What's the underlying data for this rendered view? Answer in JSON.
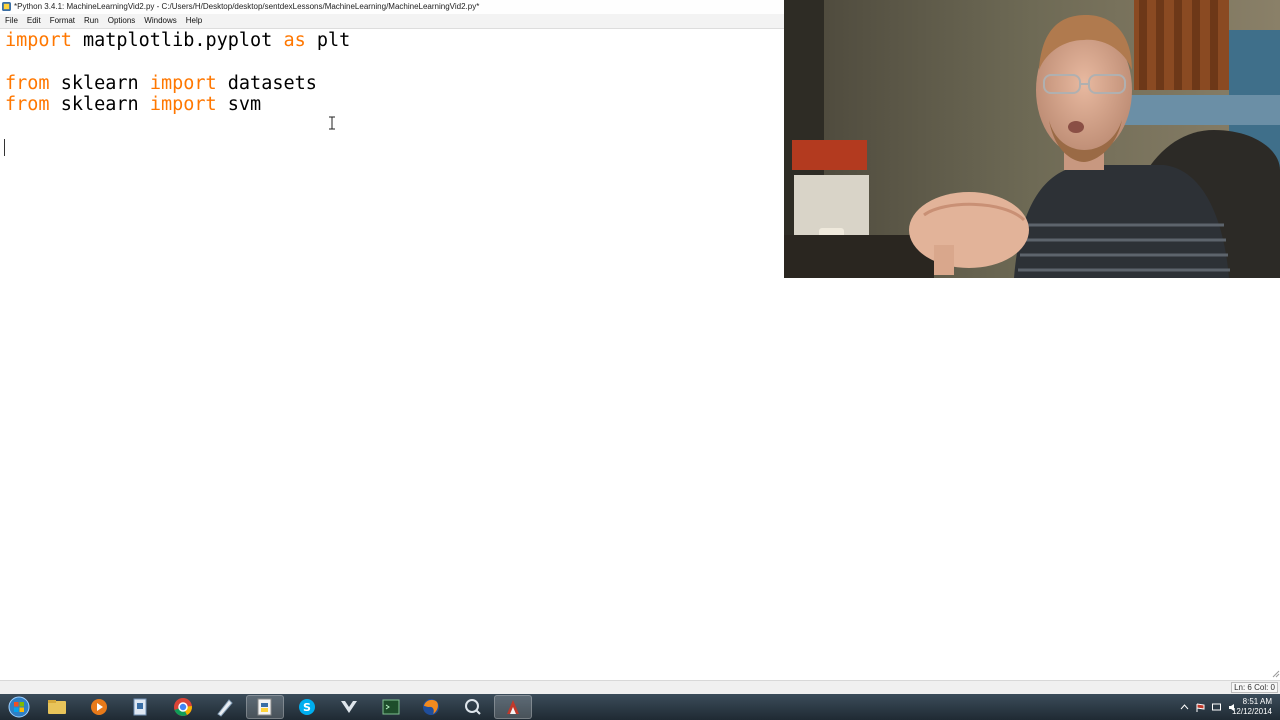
{
  "window": {
    "title": "*Python 3.4.1: MachineLearningVid2.py - C:/Users/H/Desktop/desktop/sentdexLessons/MachineLearning/MachineLearningVid2.py*"
  },
  "menu": [
    "File",
    "Edit",
    "Format",
    "Run",
    "Options",
    "Windows",
    "Help"
  ],
  "code": {
    "line1": {
      "kw1": "import",
      "t1": " matplotlib.pyplot ",
      "kw2": "as",
      "t2": " plt"
    },
    "line3": {
      "kw1": "from",
      "t1": " sklearn ",
      "kw2": "import",
      "t2": " datasets"
    },
    "line4": {
      "kw1": "from",
      "t1": " sklearn ",
      "kw2": "import",
      "t2": " svm"
    }
  },
  "status": {
    "position": "Ln: 6 Col: 0"
  },
  "clock": {
    "time": "8:51 AM",
    "date": "12/12/2014"
  },
  "colors": {
    "keyword": "#ff7700",
    "taskbar": "#2b3843"
  },
  "taskbar_icons": [
    "windows-start-icon",
    "file-explorer-icon",
    "media-player-icon",
    "documents-icon",
    "chrome-icon",
    "editor-icon",
    "python-idle-icon",
    "skype-icon",
    "tool-icon",
    "terminal-icon",
    "firefox-icon",
    "search-app-icon",
    "paint-icon"
  ]
}
